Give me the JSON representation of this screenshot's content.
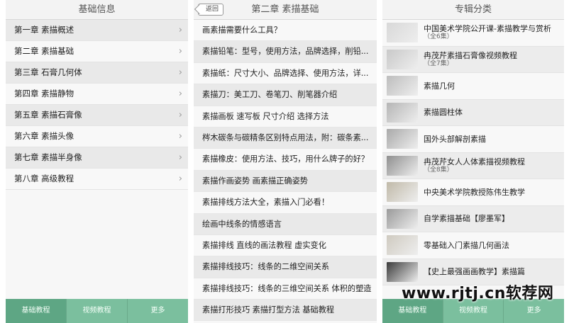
{
  "panel1": {
    "title": "基础信息",
    "items": [
      {
        "label": "第一章 素描概述"
      },
      {
        "label": "第二章 素描基础"
      },
      {
        "label": "第三章 石膏几何体"
      },
      {
        "label": "第四章 素描静物"
      },
      {
        "label": "第五章 素描石膏像"
      },
      {
        "label": "第六章 素描头像"
      },
      {
        "label": "第七章 素描半身像"
      },
      {
        "label": "第八章 高级教程"
      }
    ],
    "tabs": [
      "基础教程",
      "视频教程",
      "更多"
    ]
  },
  "panel2": {
    "back_label": "返回",
    "title": "第二章 素描基础",
    "items": [
      "画素描需要什么工具？",
      "素描铅笔：型号，使用方法，品牌选择，削铅...",
      "素描纸：尺寸大小、品牌选择、使用方法，详...",
      "素描刀：美工刀、卷笔刀、削笔器介绍",
      "素描画板 速写板 尺寸介绍 选择方法",
      "梣木碳条与碳精条区别特点用法，附：碳条素...",
      "素描橡皮：使用方法、技巧，用什么牌子的好？",
      "素描作画姿势 画素描正确姿势",
      "素描排线方法大全，素描入门必看！",
      "绘画中线条的情感语言",
      "素描排线 直线的画法教程 虚实变化",
      "素描排线技巧：线条的二维空间关系",
      "素描排线技巧：线条的三维空间关系 体积的塑造",
      "素描打形技巧 素描打型方法 基础教程"
    ]
  },
  "panel3": {
    "title": "专辑分类",
    "items": [
      {
        "title": "中国美术学院公开课-素描教学与赏析",
        "sub": "（全6集）",
        "thumb": "#d8d8d8"
      },
      {
        "title": "冉茂芹素描石膏像视频教程",
        "sub": "（全7集）",
        "thumb": "#c9c9c9"
      },
      {
        "title": "素描几何",
        "sub": "",
        "thumb": "#bdbdbd"
      },
      {
        "title": "素描圆柱体",
        "sub": "",
        "thumb": "#b5b5b5"
      },
      {
        "title": "国外头部解剖素描",
        "sub": "",
        "thumb": "#a9a9a9"
      },
      {
        "title": "冉茂芹女人人体素描视频教程",
        "sub": "（全8集）",
        "thumb": "#8f8f8f"
      },
      {
        "title": "中央美术学院教授陈伟生教学",
        "sub": "",
        "thumb": "#c0b9a8"
      },
      {
        "title": "自学素描基础【廖墨军】",
        "sub": "",
        "thumb": "#9a9a9a"
      },
      {
        "title": "零基础入门素描几何画法",
        "sub": "",
        "thumb": "#cfcac0"
      },
      {
        "title": "【史上最强画画教学】素描篇",
        "sub": "",
        "thumb": "#3a3a3a"
      }
    ],
    "tabs": [
      "基础教程",
      "视频教程",
      "更多"
    ]
  },
  "watermark": "www.rjtj.cn软荐网"
}
